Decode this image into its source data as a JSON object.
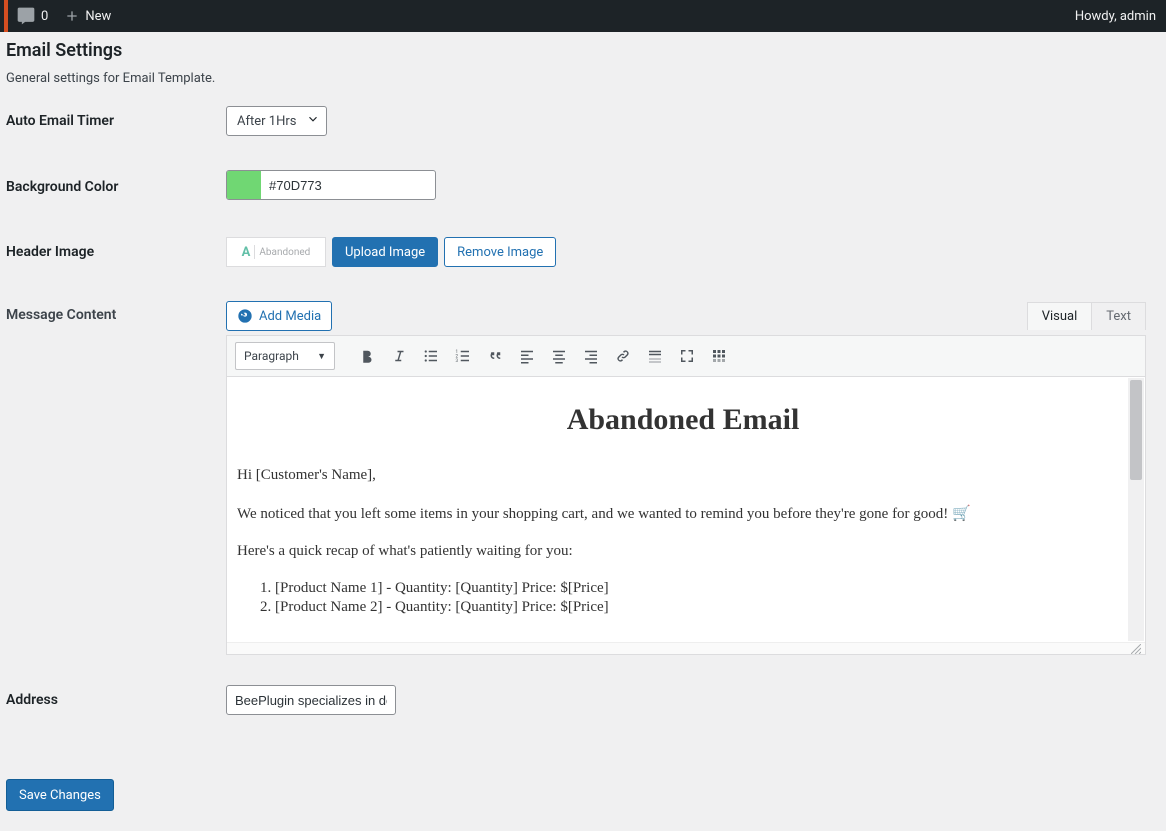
{
  "adminbar": {
    "comments_count": "0",
    "new_label": "New",
    "howdy": "Howdy, admin"
  },
  "page": {
    "title": "Email Settings",
    "subtitle": "General settings for Email Template."
  },
  "fields": {
    "timer_label": "Auto Email Timer",
    "timer_value": "After 1Hrs",
    "bgcolor_label": "Background Color",
    "bgcolor_value": "#70D773",
    "header_label": "Header Image",
    "header_preview_text": "Abandoned",
    "upload_btn": "Upload Image",
    "remove_btn": "Remove Image",
    "message_label": "Message Content",
    "add_media": "Add Media",
    "tab_visual": "Visual",
    "tab_text": "Text",
    "paragraph_label": "Paragraph",
    "address_label": "Address",
    "address_value": "BeePlugin specializes in de",
    "save": "Save Changes"
  },
  "editor_content": {
    "heading": "Abandoned Email",
    "greeting": "Hi [Customer's Name],",
    "line1": "We noticed that you left some items in your shopping cart, and we wanted to remind you before they're gone for good! 🛒",
    "line2": "Here's a quick recap of what's patiently waiting for you:",
    "items": [
      "[Product Name 1] - Quantity: [Quantity] Price: $[Price]",
      "[Product Name 2] - Quantity: [Quantity] Price: $[Price]"
    ]
  }
}
